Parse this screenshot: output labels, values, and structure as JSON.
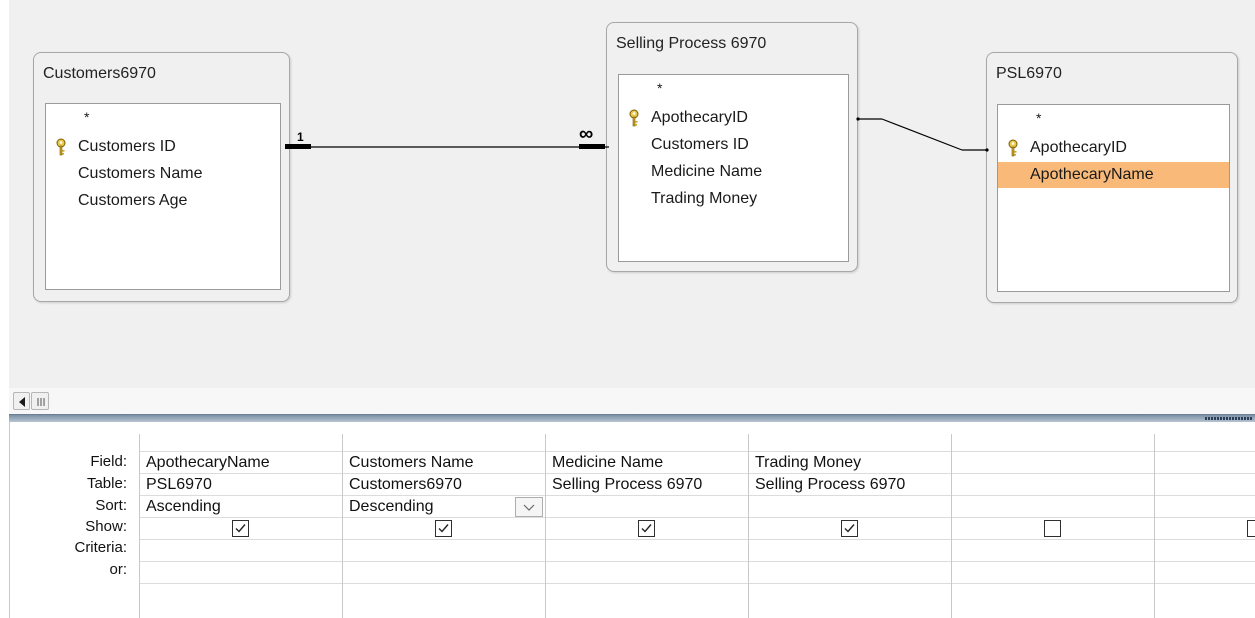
{
  "tables": {
    "customers": {
      "title": "Customers6970",
      "star": "*",
      "fields": [
        "Customers ID",
        "Customers Name",
        "Customers Age"
      ]
    },
    "selling": {
      "title": "Selling Process 6970",
      "star": "*",
      "fields": [
        "ApothecaryID",
        "Customers ID",
        "Medicine Name",
        "Trading Money"
      ]
    },
    "psl": {
      "title": "PSL6970",
      "star": "*",
      "fields": [
        "ApothecaryID",
        "ApothecaryName"
      ]
    }
  },
  "relationship": {
    "one_label": "1",
    "many_label": "∞"
  },
  "grid": {
    "row_labels": [
      "Field:",
      "Table:",
      "Sort:",
      "Show:",
      "Criteria:",
      "or:"
    ],
    "columns": [
      {
        "field": "ApothecaryName",
        "table": "PSL6970",
        "sort": "Ascending",
        "show": true
      },
      {
        "field": "Customers Name",
        "table": "Customers6970",
        "sort": "Descending",
        "show": true
      },
      {
        "field": "Medicine Name",
        "table": "Selling Process 6970",
        "sort": "",
        "show": true
      },
      {
        "field": "Trading Money",
        "table": "Selling Process 6970",
        "sort": "",
        "show": true
      },
      {
        "field": "",
        "table": "",
        "sort": "",
        "show": false
      },
      {
        "field": "",
        "table": "",
        "sort": "",
        "show": false
      }
    ]
  },
  "colors": {
    "selected_field": "#f9b978",
    "pane_bg": "#f0f0f0",
    "key_icon": "#c9a227"
  },
  "icons": {
    "primary_key": "key-icon",
    "scroll_left": "arrow-left-icon",
    "scroll_thumb": "grip-icon",
    "dropdown": "chevron-down-icon",
    "checked": "checkbox-checked",
    "unchecked": "checkbox-unchecked"
  }
}
